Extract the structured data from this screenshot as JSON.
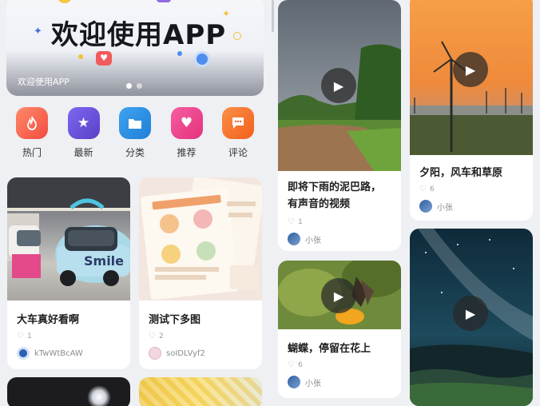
{
  "banner": {
    "title": "欢迎使用APP",
    "caption": "欢迎使用APP",
    "page_count": 2,
    "active_page": 1
  },
  "quick_nav": [
    {
      "label": "热门",
      "icon": "flame-icon",
      "color": "#f6614d"
    },
    {
      "label": "最新",
      "icon": "star-icon",
      "color": "#6b53d8"
    },
    {
      "label": "分类",
      "icon": "folder-icon",
      "color": "#2a8ee8"
    },
    {
      "label": "推荐",
      "icon": "heart-icon",
      "color": "#ef3e8c"
    },
    {
      "label": "评论",
      "icon": "comment-icon",
      "color": "#f7752c"
    }
  ],
  "feed": {
    "left_column": [
      {
        "title": "大车真好看啊",
        "likes": "1",
        "author": "kTwWtBcAW",
        "type": "image"
      },
      {
        "title": "测试下多图",
        "likes": "2",
        "author": "soIDLVyf2",
        "type": "image"
      }
    ],
    "middle_column": [
      {
        "title_line1": "即将下雨的泥巴路，",
        "title_line2": "有声音的视频",
        "likes": "1",
        "author": "小张",
        "type": "video"
      },
      {
        "title": "蝴蝶，停留在花上",
        "likes": "6",
        "author": "小张",
        "type": "video"
      }
    ],
    "right_column": [
      {
        "title": "夕阳，风车和草原",
        "likes": "6",
        "author": "小张",
        "type": "video"
      },
      {
        "title": "",
        "type": "video"
      }
    ]
  },
  "colors": {
    "background": "#eef0f3",
    "card": "#ffffff",
    "muted_text": "#9a9ca3"
  }
}
